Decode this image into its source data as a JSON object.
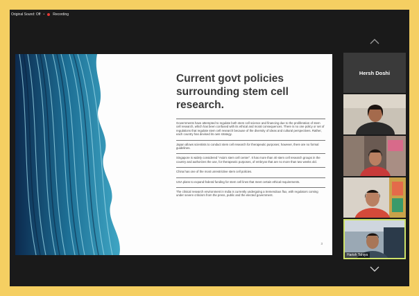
{
  "meeting": {
    "original_sound": "Original Sound: Off",
    "separator": "•",
    "recording_label": "Recording"
  },
  "slide": {
    "title": "Current govt policies surrounding stem cell research.",
    "bullets": [
      "Governments have attempted to regulate both stem cell science and financing due to the proliferation of stem cell research, which has been confused with its ethical and moral consequences. There is no one policy or set of regulations that regulate stem cell research because of the diversity of ideas and cultural perspectives. Rather, each country has devised its own strategy.",
      "Japan allows scientists to conduct stem cell research for therapeutic purposes; however, there are no formal guidelines.",
      "Singapore is widely considered \"Asia's stem cell center\". It has more than 40 stem cell research groups in the country and authorizes the use, for therapeutic purposes, of embryos that are no more than two weeks old.",
      "China has one of the most unrestrictive stem cell policies.",
      "USA plans to expand federal funding for stem cell lines that meet certain ethical requirements.",
      "The clinical research environment in India is currently undergoing a tremendous flux, with regulators coming under severe criticism from the press, public and the elected government."
    ],
    "page_number": "3"
  },
  "participants": [
    {
      "name": "Hersh Doshi",
      "video": false,
      "label_shown": true
    },
    {
      "name": "",
      "video": true,
      "label_shown": false
    },
    {
      "name": "",
      "video": true,
      "label_shown": false
    },
    {
      "name": "",
      "video": true,
      "label_shown": false
    },
    {
      "name": "Harish Tahiya",
      "video": true,
      "label_shown": true,
      "active_speaker": true
    }
  ],
  "icons": {
    "scroll_up": "chevron-up-icon",
    "scroll_down": "chevron-down-icon",
    "recording": "record-dot-icon"
  },
  "colors": {
    "page_border": "#f5cf62",
    "background": "#1a1a1a",
    "recording": "#e53935",
    "active_speaker": "#cfe36a"
  }
}
